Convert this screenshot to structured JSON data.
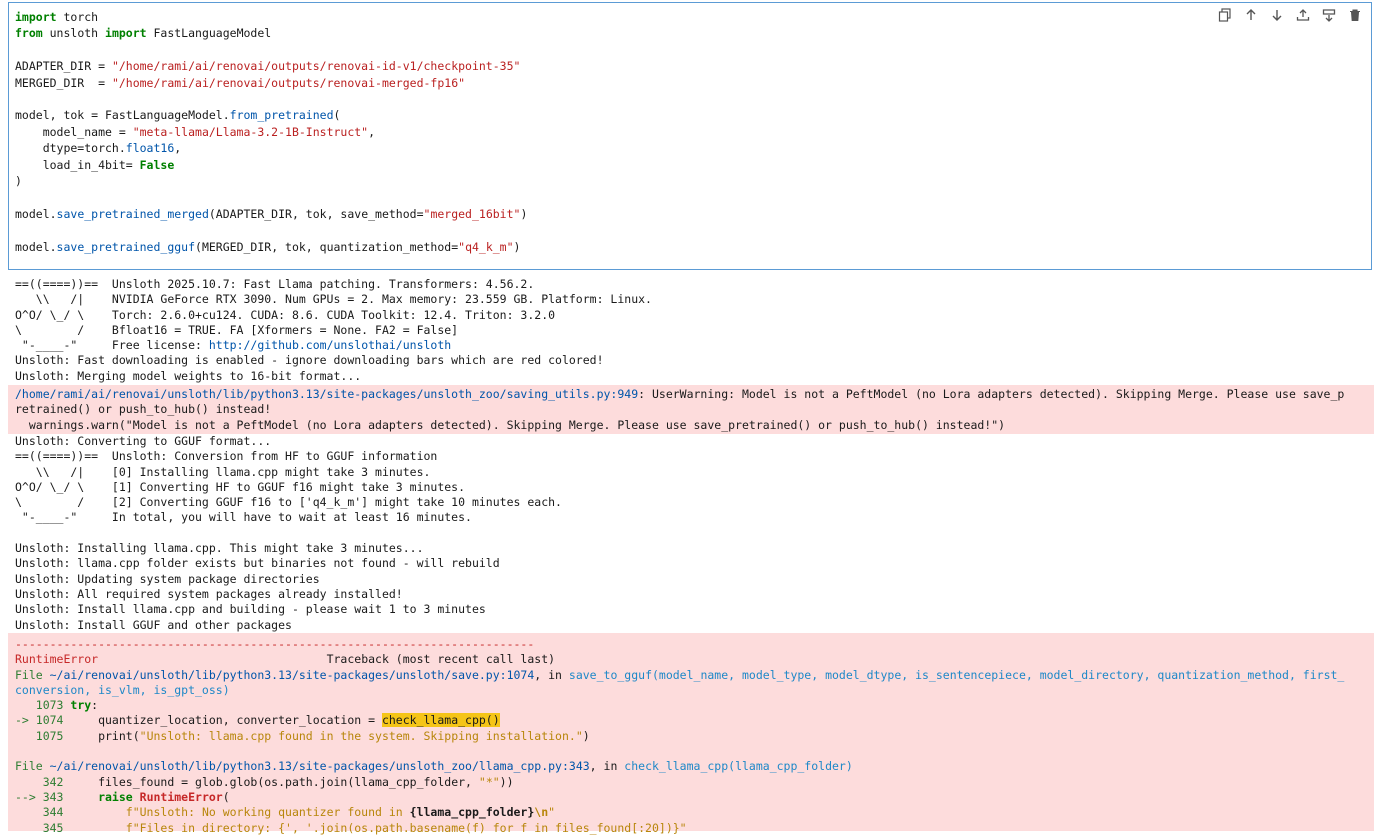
{
  "cell": {
    "lines": {
      "l1_kw": "import",
      "l1_rest": " torch",
      "l2_kw1": "from",
      "l2_mid": " unsloth ",
      "l2_kw2": "import",
      "l2_rest": " FastLanguageModel",
      "l4_a": "ADAPTER_DIR = ",
      "l4_s": "\"/home/rami/ai/renovai/outputs/renovai-id-v1/checkpoint-35\"",
      "l5_a": "MERGED_DIR  = ",
      "l5_s": "\"/home/rami/ai/renovai/outputs/renovai-merged-fp16\"",
      "l7_a": "model, tok = FastLanguageModel.",
      "l7_f": "from_pretrained",
      "l7_b": "(",
      "l8_a": "    model_name = ",
      "l8_s": "\"meta-llama/Llama-3.2-1B-Instruct\"",
      "l8_b": ",",
      "l9_a": "    dtype=torch.",
      "l9_f": "float16",
      "l9_b": ",",
      "l10_a": "    load_in_4bit= ",
      "l10_k": "False",
      "l11": ")",
      "l13_a": "model.",
      "l13_f": "save_pretrained_merged",
      "l13_b": "(ADAPTER_DIR, tok, save_method=",
      "l13_s": "\"merged_16bit\"",
      "l13_c": ")",
      "l15_a": "model.",
      "l15_f": "save_pretrained_gguf",
      "l15_b": "(MERGED_DIR, tok, quantization_method=",
      "l15_s": "\"q4_k_m\"",
      "l15_c": ")"
    }
  },
  "toolbar": {
    "icons": [
      "copy-icon",
      "arrow-up-icon",
      "arrow-down-icon",
      "insert-above-icon",
      "insert-below-icon",
      "trash-icon"
    ]
  },
  "out1": {
    "l1": "==((====))==  Unsloth 2025.10.7: Fast Llama patching. Transformers: 4.56.2.",
    "l2": "   \\\\   /|    NVIDIA GeForce RTX 3090. Num GPUs = 2. Max memory: 23.559 GB. Platform: Linux.",
    "l3": "O^O/ \\_/ \\    Torch: 2.6.0+cu124. CUDA: 8.6. CUDA Toolkit: 12.4. Triton: 3.2.0",
    "l4": "\\        /    Bfloat16 = TRUE. FA [Xformers = None. FA2 = False]",
    "l5a": " \"-____-\"     Free license: ",
    "l5b": "http://github.com/unslothai/unsloth",
    "l6": "Unsloth: Fast downloading is enabled - ignore downloading bars which are red colored!",
    "l7": "Unsloth: Merging model weights to 16-bit format..."
  },
  "warn": {
    "path": "/home/rami/ai/renovai/unsloth/lib/python3.13/site-packages/unsloth_zoo/saving_utils.py:949",
    "msg1": ": UserWarning: Model is not a PeftModel (no Lora adapters detected). Skipping Merge. Please use save_p",
    "msg2": "retrained() or push_to_hub() instead!",
    "msg3": "  warnings.warn(\"Model is not a PeftModel (no Lora adapters detected). Skipping Merge. Please use save_pretrained() or push_to_hub() instead!\")"
  },
  "out2": {
    "l1": "Unsloth: Converting to GGUF format...",
    "l2": "==((====))==  Unsloth: Conversion from HF to GGUF information",
    "l3": "   \\\\   /|    [0] Installing llama.cpp might take 3 minutes.",
    "l4": "O^O/ \\_/ \\    [1] Converting HF to GGUF f16 might take 3 minutes.",
    "l5": "\\        /    [2] Converting GGUF f16 to ['q4_k_m'] might take 10 minutes each.",
    "l6": " \"-____-\"     In total, you will have to wait at least 16 minutes.",
    "l7": "",
    "l8": "Unsloth: Installing llama.cpp. This might take 3 minutes...",
    "l9": "Unsloth: llama.cpp folder exists but binaries not found - will rebuild",
    "l10": "Unsloth: Updating system package directories",
    "l11": "Unsloth: All required system packages already installed!",
    "l12": "Unsloth: Install llama.cpp and building - please wait 1 to 3 minutes",
    "l13": "Unsloth: Install GGUF and other packages"
  },
  "tb": {
    "dashes": "---------------------------------------------------------------------------",
    "err_name": "RuntimeError",
    "tb_head": "                                 Traceback (most recent call last)",
    "f1_pre": "File ",
    "f1_path": "~/ai/renovai/unsloth/lib/python3.13/site-packages/unsloth/save.py:1074",
    "f1_in": ", in ",
    "f1_fn": "save_to_gguf(model_name, model_type, model_dtype, is_sentencepiece, model_directory, quantization_method, first_",
    "f1_fn2": "conversion, is_vlm, is_gpt_oss)",
    "c1_no": "   1073 ",
    "c1_kw": "try",
    "c1_rest": ":",
    "c2_no": "-> 1074 ",
    "c2_a": "    quantizer_location, converter_location = ",
    "c2_hl": "check_llama_cpp()",
    "c3_no": "   1075 ",
    "c3_a": "    print(",
    "c3_s": "\"Unsloth: llama.cpp found in the system. Skipping installation.\"",
    "c3_b": ")",
    "f2_pre": "File ",
    "f2_path": "~/ai/renovai/unsloth/lib/python3.13/site-packages/unsloth_zoo/llama_cpp.py:343",
    "f2_in": ", in ",
    "f2_fn": "check_llama_cpp(llama_cpp_folder)",
    "d1_no": "    342 ",
    "d1_a": "    files_found = glob.glob(os.path.join(llama_cpp_folder, ",
    "d1_s": "\"*\"",
    "d1_b": "))",
    "d2_no": "--> 343 ",
    "d2_kw": "    raise ",
    "d2_err": "RuntimeError",
    "d2_b": "(",
    "d3_no": "    344 ",
    "d3_s": "        f\"Unsloth: No working quantizer found in ",
    "d3_b": "{llama_cpp_folder}",
    "d3_e": "\\n",
    "d3_q": "\"",
    "d4_no": "    345 ",
    "d4_s": "        f\"Files in directory: {', '.join(os.path.basename(f) for f in files_found[:20])}\""
  }
}
